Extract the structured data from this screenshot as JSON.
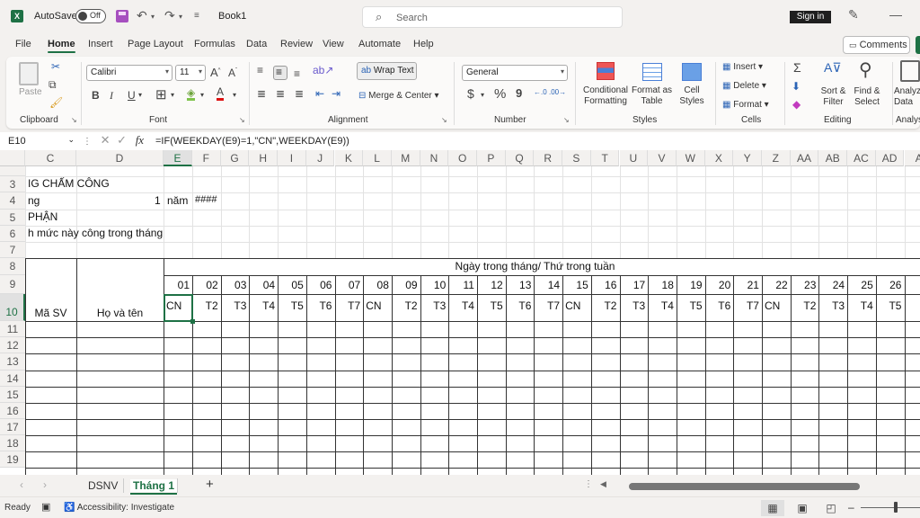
{
  "titlebar": {
    "app_logo": "X",
    "autosave_label": "AutoSave",
    "autosave_state": "Off",
    "undo_icon": "↶",
    "redo_icon": "↷",
    "customize_icon": "≡",
    "book_title": "Book1",
    "search_placeholder": "Search",
    "search_icon": "⌕",
    "sign_in": "Sign in",
    "pen_icon": "✎",
    "minimize_icon": "—"
  },
  "tabs": [
    {
      "label": "File"
    },
    {
      "label": "Home",
      "active": true
    },
    {
      "label": "Insert"
    },
    {
      "label": "Page Layout"
    },
    {
      "label": "Formulas"
    },
    {
      "label": "Data"
    },
    {
      "label": "Review"
    },
    {
      "label": "View"
    },
    {
      "label": "Automate"
    },
    {
      "label": "Help"
    }
  ],
  "comments_label": "Comments",
  "comments_icon": "🗩",
  "ribbon": {
    "clipboard": {
      "paste": "Paste",
      "label": "Clipboard",
      "cut_icon": "✂",
      "copy_icon": "⧉",
      "painter_icon": "🖌"
    },
    "font": {
      "name": "Calibri",
      "size": "11",
      "grow": "A^",
      "shrink": "Aˇ",
      "bold": "B",
      "italic": "I",
      "underline": "U",
      "borders_icon": "⊞",
      "fill_icon": "◈",
      "color_icon": "A",
      "label": "Font"
    },
    "alignment": {
      "wrap_text": "Wrap Text",
      "merge_center": "Merge & Center",
      "label": "Alignment"
    },
    "number": {
      "format": "General",
      "currency": "$",
      "percent": "%",
      "comma": "9",
      "inc_dec": "←.0",
      "dec_dec": ".00→",
      "label": "Number"
    },
    "styles": {
      "conditional": "Conditional Formatting",
      "format_table": "Format as Table",
      "cell_styles": "Cell Styles",
      "label": "Styles"
    },
    "cells": {
      "insert": "Insert",
      "delete": "Delete",
      "format": "Format",
      "label": "Cells"
    },
    "editing": {
      "sum_icon": "Σ",
      "fill_icon": "⬇",
      "clear_icon": "◆",
      "sort_filter": "Sort & Filter",
      "find_select": "Find & Select",
      "label": "Editing"
    },
    "analysis": {
      "analyze": "Analyze Data",
      "label": "Analysis"
    }
  },
  "formula_bar": {
    "name_box": "E10",
    "cancel_icon": "✕",
    "enter_icon": "✓",
    "fx_icon": "fx",
    "formula": "=IF(WEEKDAY(E9)=1,\"CN\",WEEKDAY(E9))"
  },
  "columns": [
    "C",
    "D",
    "E",
    "F",
    "G",
    "H",
    "I",
    "J",
    "K",
    "L",
    "M",
    "N",
    "O",
    "P",
    "Q",
    "R",
    "S",
    "T",
    "U",
    "V",
    "W",
    "X",
    "Y",
    "Z",
    "AA",
    "AB",
    "AC",
    "AD",
    "A"
  ],
  "selected_column": "E",
  "rows": [
    "3",
    "4",
    "5",
    "6",
    "7",
    "8",
    "9",
    "10",
    "11",
    "12",
    "13",
    "14",
    "15",
    "16",
    "17",
    "18",
    "19"
  ],
  "selected_row": "10",
  "cells": {
    "c3": "IG CHẤM CÔNG",
    "c4": "ng",
    "d4": "1",
    "e4": "năm",
    "f4": "####",
    "c5": "PHẬN",
    "c6": "h mức này công trong tháng",
    "c10": "Mã SV",
    "d10": "Họ và tên",
    "header_merged": "Ngày trong tháng/ Thứ trong tuần"
  },
  "days": [
    "01",
    "02",
    "03",
    "04",
    "05",
    "06",
    "07",
    "08",
    "09",
    "10",
    "11",
    "12",
    "13",
    "14",
    "15",
    "16",
    "17",
    "18",
    "19",
    "20",
    "21",
    "22",
    "23",
    "24",
    "25",
    "26"
  ],
  "weekdays": [
    "CN",
    "T2",
    "T3",
    "T4",
    "T5",
    "T6",
    "T7",
    "CN",
    "T2",
    "T3",
    "T4",
    "T5",
    "T6",
    "T7",
    "CN",
    "T2",
    "T3",
    "T4",
    "T5",
    "T6",
    "T7",
    "CN",
    "T2",
    "T3",
    "T4",
    "T5"
  ],
  "sheet_tabs": [
    {
      "label": "DSNV"
    },
    {
      "label": "Tháng 1",
      "active": true
    }
  ],
  "add_sheet": "+",
  "status": {
    "ready": "Ready",
    "accessibility": "Accessibility: Investigate"
  },
  "colors": {
    "accent": "#1e7145",
    "background": "#f3f1ef"
  }
}
